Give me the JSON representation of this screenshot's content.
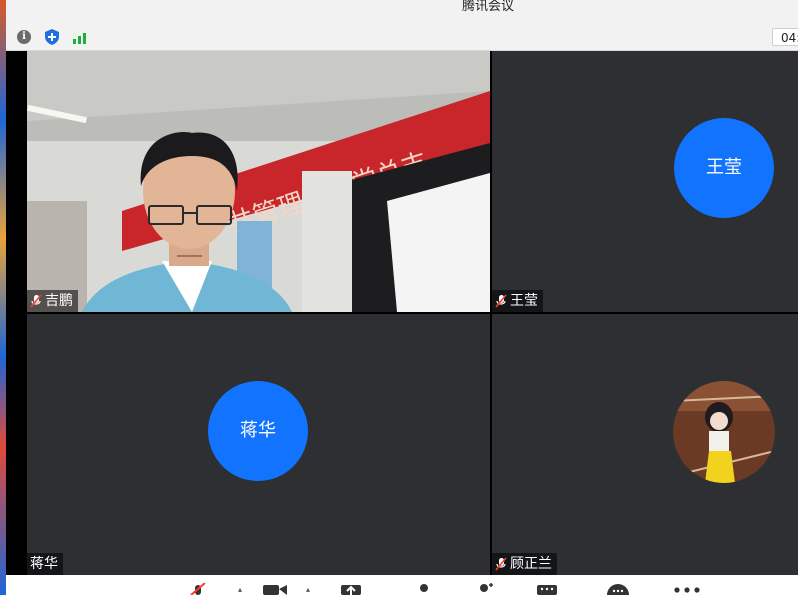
{
  "window": {
    "title": "腾讯会议"
  },
  "infobar": {
    "timer": "04:"
  },
  "participants": [
    {
      "name": "吉鹏",
      "mic_muted": true,
      "video": true
    },
    {
      "name": "王莹",
      "mic_muted": true,
      "avatar_text": "王莹"
    },
    {
      "name": "蒋华",
      "mic_muted": false,
      "avatar_text": "蒋华"
    },
    {
      "name": "顾正兰",
      "mic_muted": true,
      "avatar_image": "anime-figure"
    }
  ],
  "video_scene": {
    "banner_text": "共管理学院党总支"
  },
  "colors": {
    "accent": "#1273ff",
    "tile_bg": "#2d2f33",
    "banner": "#c8262b"
  },
  "toolbar": {
    "icons": [
      "unmute-mic-icon",
      "camera-icon",
      "share-screen-icon",
      "members-icon",
      "invite-icon",
      "apps-icon",
      "chat-icon",
      "more-icon"
    ]
  }
}
